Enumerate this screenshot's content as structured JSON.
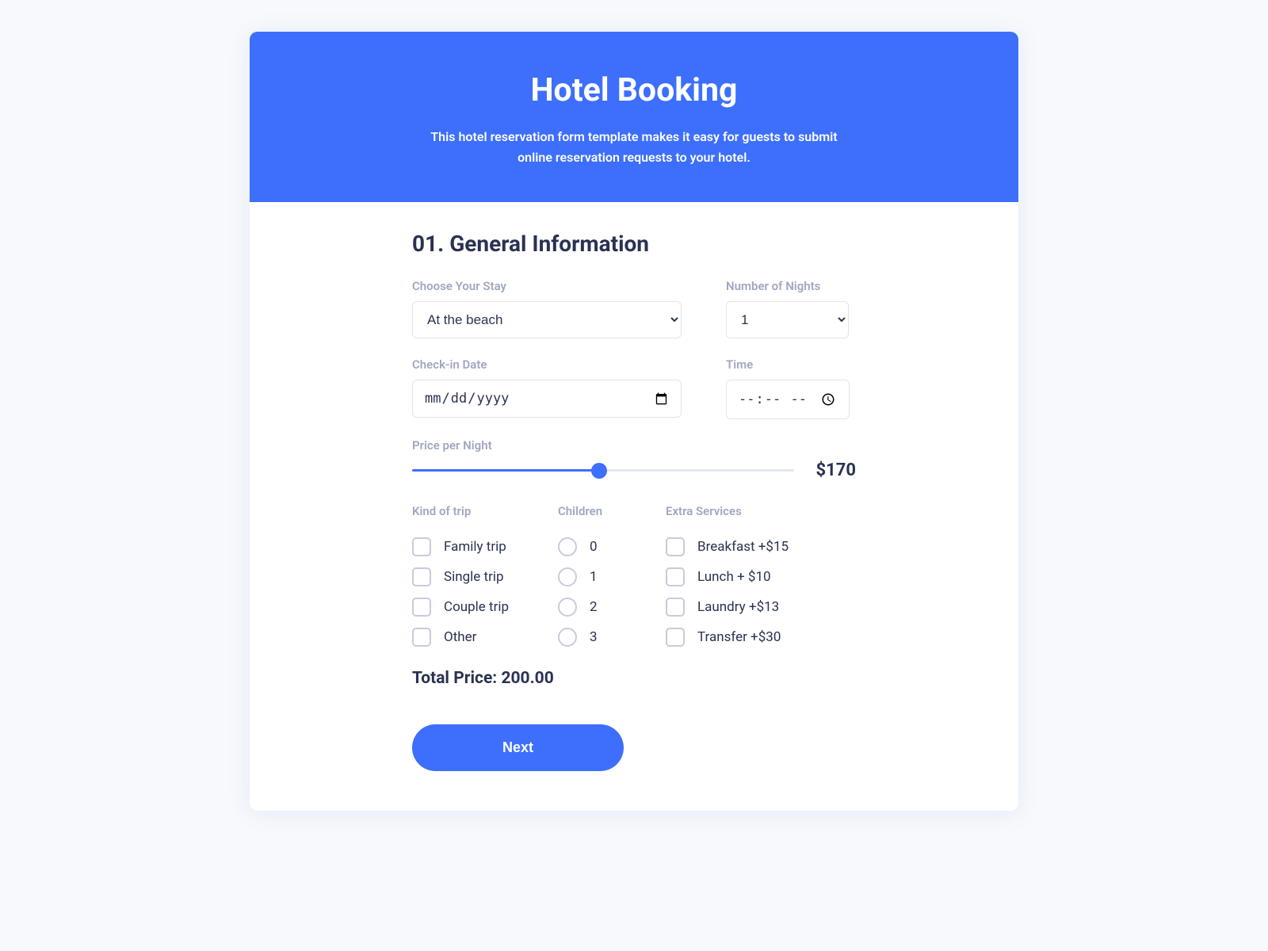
{
  "header": {
    "title": "Hotel Booking",
    "subtitle": "This hotel reservation form template makes it easy for guests to submit online reservation requests to your hotel."
  },
  "section": {
    "title": "01. General Information"
  },
  "fields": {
    "stay": {
      "label": "Choose Your Stay",
      "value": "At the beach"
    },
    "nights": {
      "label": "Number of Nights",
      "value": "1"
    },
    "checkin": {
      "label": "Check-in Date",
      "placeholder": "mm/dd/yyyy"
    },
    "time": {
      "label": "Time",
      "placeholder": "--:-- --"
    },
    "price": {
      "label": "Price per Night",
      "value": "$170"
    }
  },
  "trip": {
    "label": "Kind of trip",
    "options": [
      "Family trip",
      "Single trip",
      "Couple trip",
      "Other"
    ]
  },
  "children": {
    "label": "Children",
    "options": [
      "0",
      "1",
      "2",
      "3"
    ]
  },
  "services": {
    "label": "Extra Services",
    "options": [
      "Breakfast +$15",
      "Lunch + $10",
      "Laundry +$13",
      "Transfer +$30"
    ]
  },
  "total": {
    "label": "Total Price:",
    "value": "200.00"
  },
  "next_label": "Next"
}
